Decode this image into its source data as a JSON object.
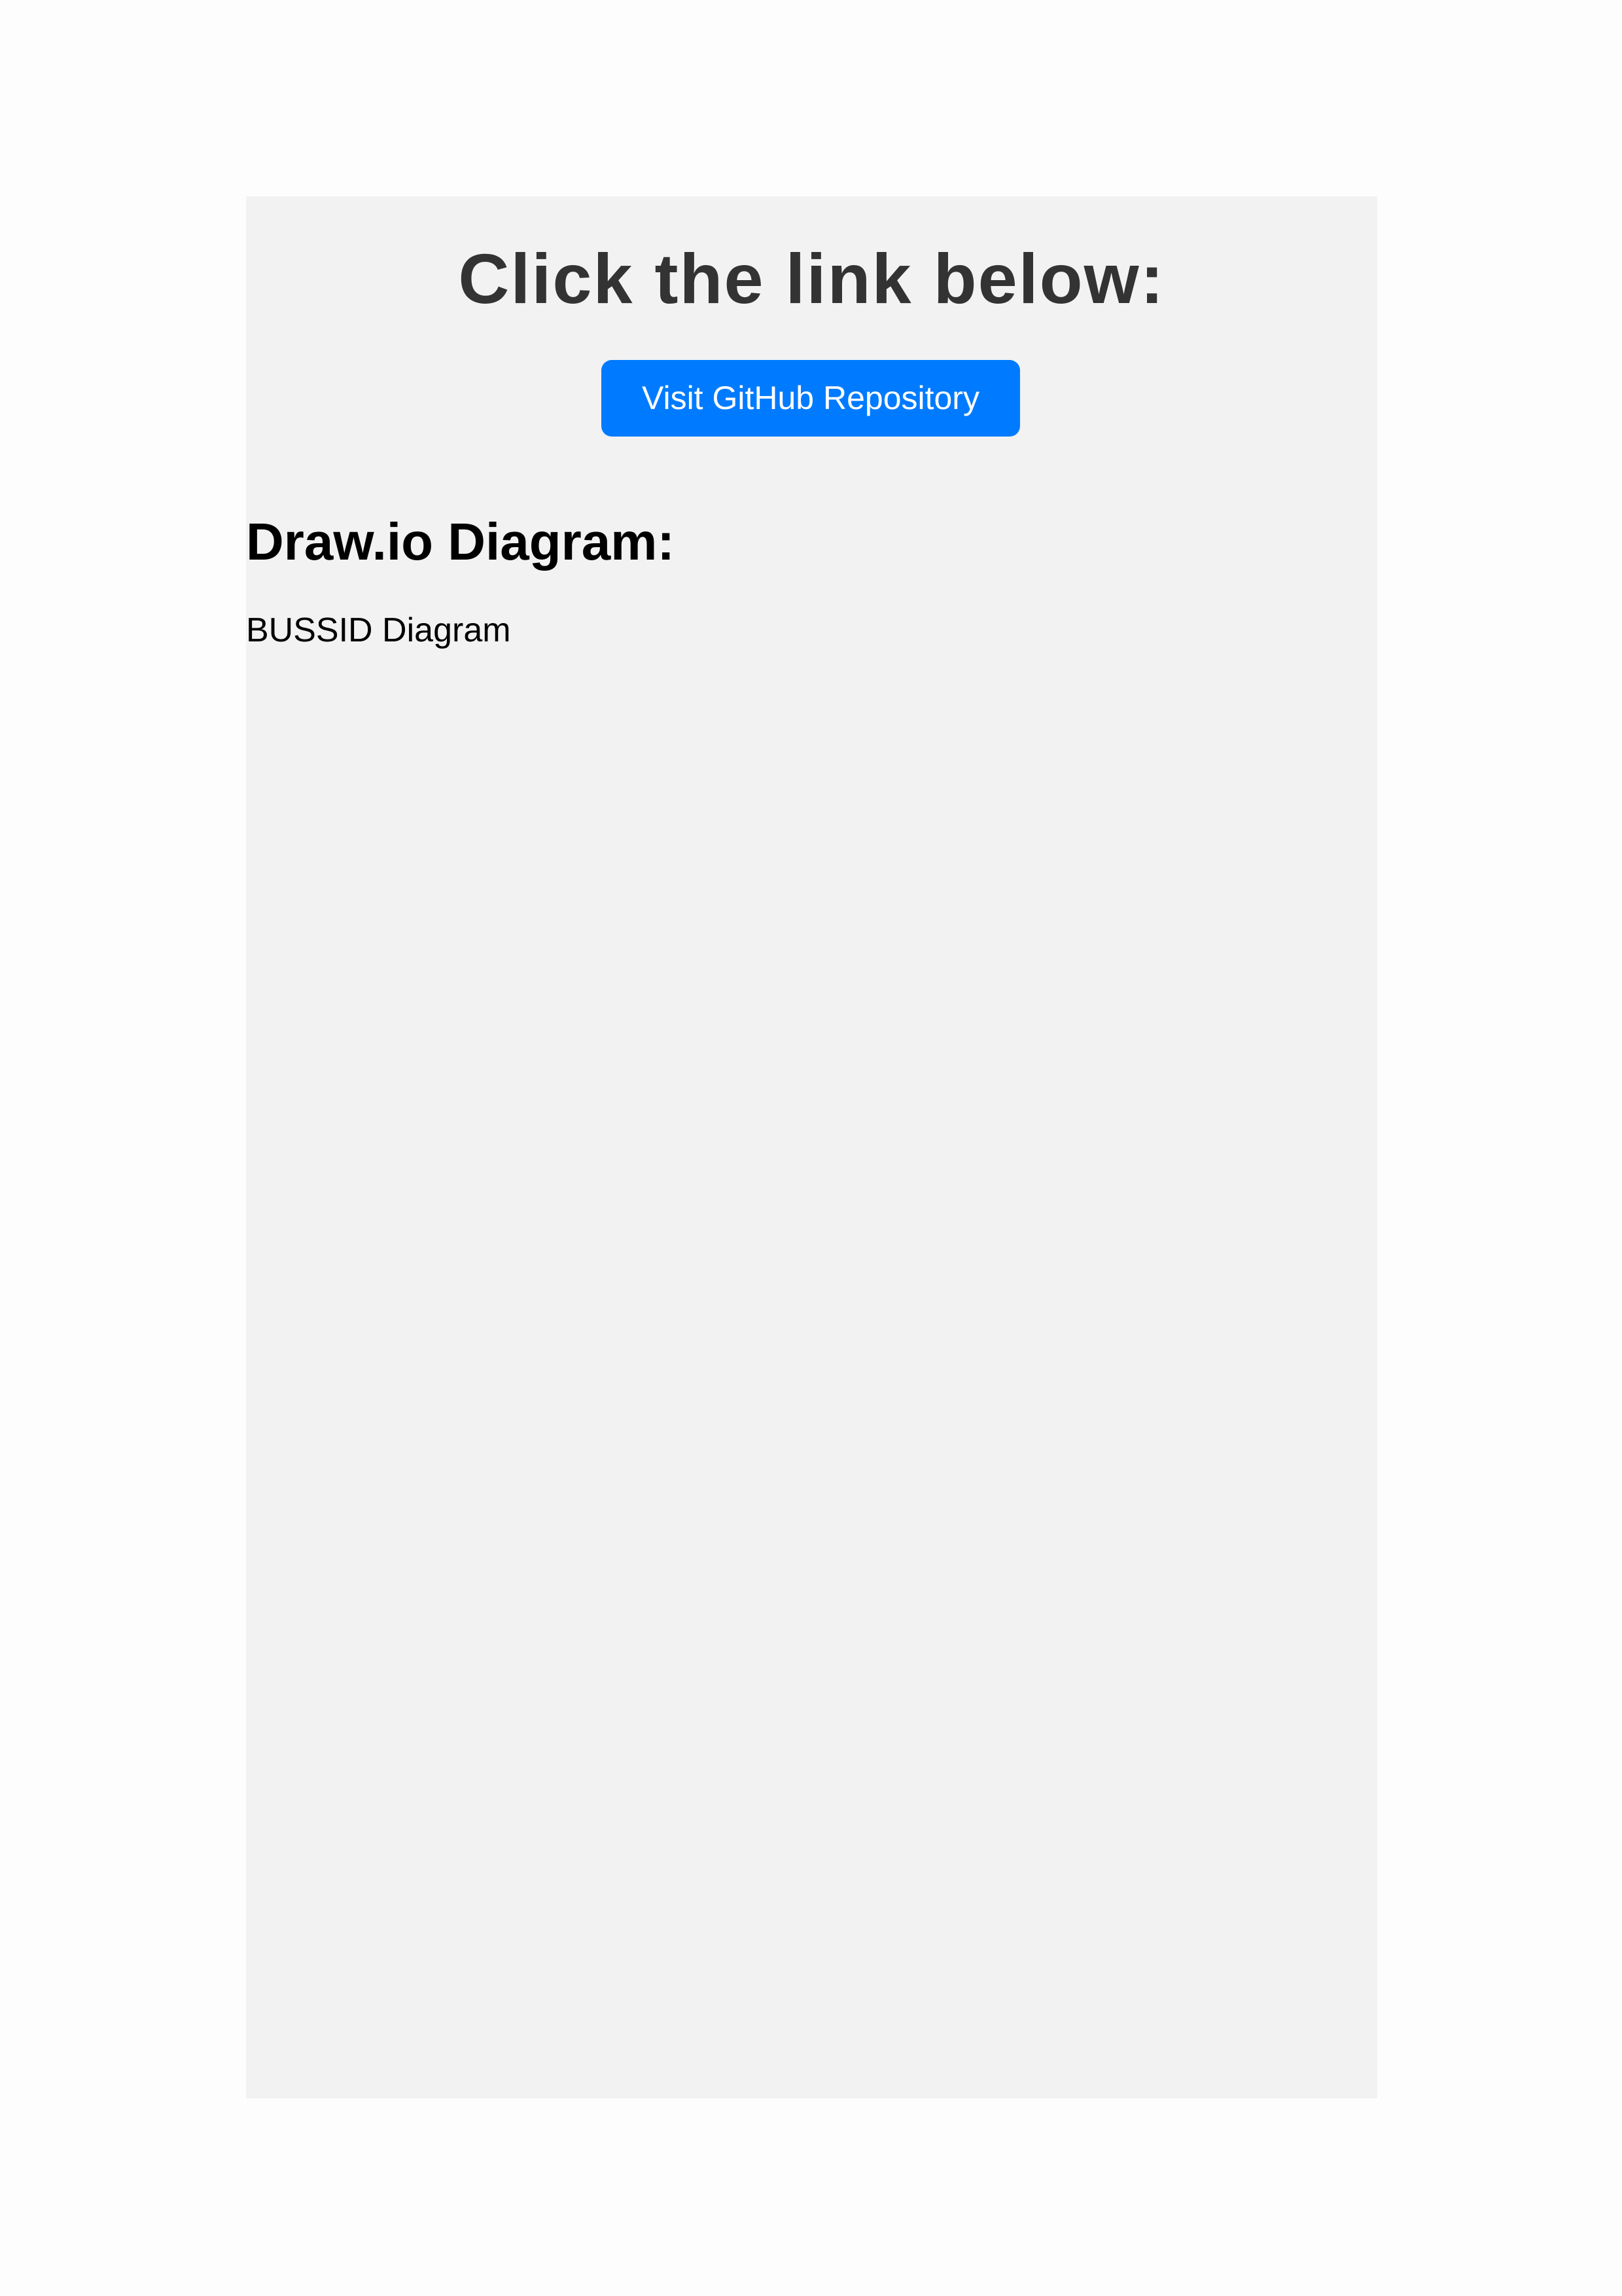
{
  "main": {
    "heading": "Click the link below:",
    "repo_button_label": "Visit GitHub Repository",
    "diagram_section_title": "Draw.io Diagram:",
    "diagram_image_alt": "BUSSID Diagram"
  },
  "colors": {
    "page_background": "#fdfdfd",
    "panel_background": "#f2f2f2",
    "heading_text": "#333333",
    "button_background": "#007bff",
    "button_text": "#ffffff",
    "body_text": "#000000"
  }
}
